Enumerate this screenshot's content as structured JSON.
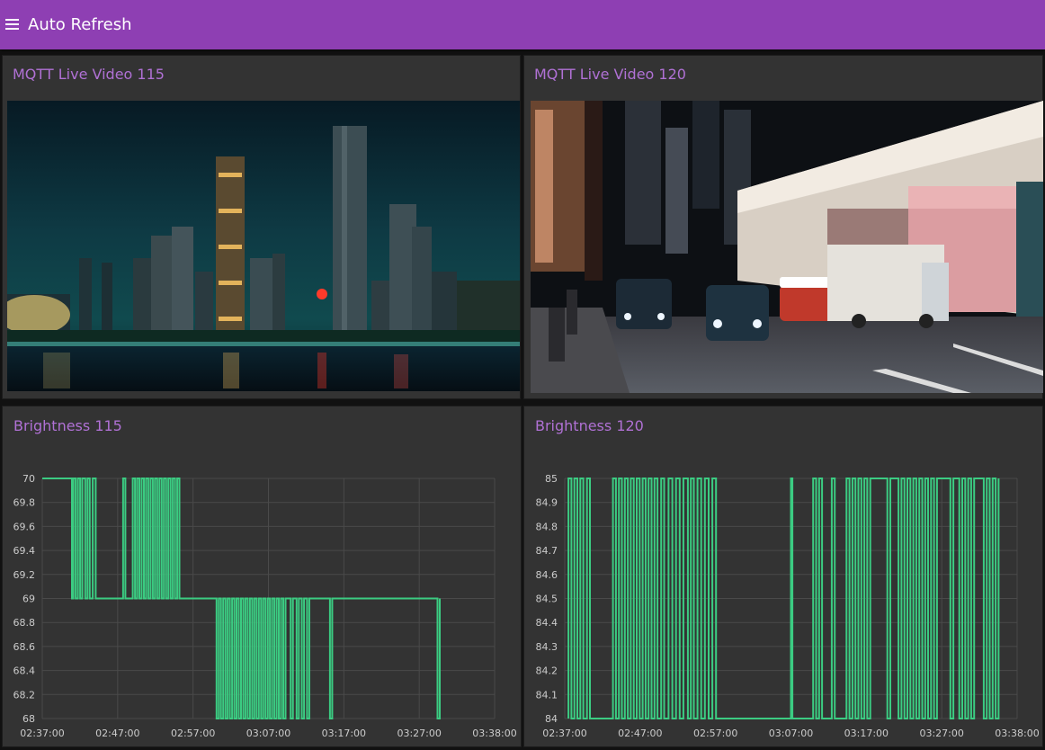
{
  "app": {
    "title": "Auto Refresh",
    "menu_icon": "hamburger-menu-icon"
  },
  "videos": [
    {
      "title": "MQTT Live Video 115",
      "scene": "night-city-skyline-over-river"
    },
    {
      "title": "MQTT Live Video 120",
      "scene": "night-street-with-taxis"
    }
  ],
  "colors": {
    "header": "#8e3fb3",
    "card_title": "#b071d5",
    "card_bg": "#333333",
    "line": "#3bcc82",
    "grid": "#4a4a4a",
    "tick_text": "#cccccc"
  },
  "chart_data": [
    {
      "type": "line",
      "title": "Brightness 115",
      "xlabel": "",
      "ylabel": "",
      "x_ticks": [
        "02:37:00",
        "02:47:00",
        "02:57:00",
        "03:07:00",
        "03:17:00",
        "03:27:00",
        "03:38:00"
      ],
      "x_range_minutes": [
        0,
        61
      ],
      "y_ticks": [
        "70",
        "69.8",
        "69.6",
        "69.4",
        "69.2",
        "69",
        "68.8",
        "68.6",
        "68.4",
        "68.2",
        "68"
      ],
      "ylim": [
        68,
        70
      ],
      "grid": true,
      "series": [
        {
          "color": "#3bcc82",
          "x_minutes": [
            0,
            4,
            4,
            4.2,
            4.2,
            4.5,
            4.5,
            4.8,
            4.8,
            5.1,
            5.1,
            5.4,
            5.4,
            5.8,
            5.8,
            6.1,
            6.1,
            6.4,
            6.4,
            6.8,
            6.8,
            7.2,
            7.2,
            10.9,
            10.9,
            11.2,
            11.2,
            12.2,
            12.2,
            12.5,
            12.5,
            12.8,
            12.8,
            13.1,
            13.1,
            13.4,
            13.4,
            13.7,
            13.7,
            14,
            14,
            14.3,
            14.3,
            14.6,
            14.6,
            14.9,
            14.9,
            15.2,
            15.2,
            15.5,
            15.5,
            15.8,
            15.8,
            16.1,
            16.1,
            16.4,
            16.4,
            16.7,
            16.7,
            17,
            17,
            17.3,
            17.3,
            17.6,
            17.6,
            17.9,
            17.9,
            18.2,
            18.2,
            18.5,
            18.5,
            23.5,
            23.5,
            23.8,
            23.8,
            24.1,
            24.1,
            24.4,
            24.4,
            24.7,
            24.7,
            25,
            25,
            25.3,
            25.3,
            25.6,
            25.6,
            25.9,
            25.9,
            26.2,
            26.2,
            26.5,
            26.5,
            26.8,
            26.8,
            27.1,
            27.1,
            27.4,
            27.4,
            27.7,
            27.7,
            28,
            28,
            28.3,
            28.3,
            28.6,
            28.6,
            28.9,
            28.9,
            29.2,
            29.2,
            29.5,
            29.5,
            29.8,
            29.8,
            30.1,
            30.1,
            30.4,
            30.4,
            30.7,
            30.7,
            31,
            31,
            31.3,
            31.3,
            31.6,
            31.6,
            31.9,
            31.9,
            32.2,
            32.2,
            32.5,
            32.5,
            32.8,
            32.8,
            33.5,
            33.5,
            33.8,
            33.8,
            34.3,
            34.3,
            34.6,
            34.6,
            35,
            35,
            35.3,
            35.3,
            35.7,
            35.7,
            36,
            36,
            38.8,
            38.8,
            39.1,
            39.1,
            53.3,
            53.3,
            53.6,
            53.6,
            61
          ],
          "values": [
            70,
            70,
            69,
            69,
            70,
            70,
            69,
            69,
            70,
            70,
            69,
            69,
            70,
            70,
            69,
            69,
            70,
            70,
            69,
            69,
            70,
            70,
            69,
            69,
            70,
            70,
            69,
            69,
            70,
            70,
            69,
            69,
            70,
            70,
            69,
            69,
            70,
            70,
            69,
            69,
            70,
            70,
            69,
            69,
            70,
            70,
            69,
            69,
            70,
            70,
            69,
            69,
            70,
            70,
            69,
            69,
            70,
            70,
            69,
            69,
            70,
            70,
            69,
            69,
            70,
            70,
            69,
            69,
            70,
            70,
            69,
            69,
            68,
            68,
            69,
            69,
            68,
            68,
            69,
            69,
            68,
            68,
            69,
            69,
            68,
            68,
            69,
            69,
            68,
            68,
            69,
            69,
            68,
            68,
            69,
            69,
            68,
            68,
            69,
            69,
            68,
            68,
            69,
            69,
            68,
            68,
            69,
            69,
            68,
            68,
            69,
            69,
            68,
            68,
            69,
            69,
            68,
            68,
            69,
            69,
            68,
            68,
            69,
            69,
            68,
            68,
            69,
            69,
            68,
            68,
            69,
            69,
            68,
            68,
            69,
            69,
            68,
            68,
            69,
            69,
            68,
            68,
            69,
            69,
            68,
            68,
            69,
            69,
            68,
            68,
            69,
            69,
            68,
            68,
            69,
            69,
            68,
            68,
            69
          ]
        }
      ]
    },
    {
      "type": "line",
      "title": "Brightness 120",
      "xlabel": "",
      "ylabel": "",
      "x_ticks": [
        "02:37:00",
        "02:47:00",
        "02:57:00",
        "03:07:00",
        "03:17:00",
        "03:27:00",
        "03:38:00"
      ],
      "x_range_minutes": [
        0,
        61
      ],
      "y_ticks": [
        "85",
        "84.9",
        "84.8",
        "84.7",
        "84.6",
        "84.5",
        "84.4",
        "84.3",
        "84.2",
        "84.1",
        "84"
      ],
      "ylim": [
        84,
        85
      ],
      "grid": true,
      "series": [
        {
          "color": "#3bcc82",
          "x_minutes": [
            0.5,
            0.5,
            0.9,
            0.9,
            1.3,
            1.3,
            1.7,
            1.7,
            2.1,
            2.1,
            2.5,
            2.5,
            3,
            3,
            3.4,
            3.4,
            6.5,
            6.5,
            6.9,
            6.9,
            7.3,
            7.3,
            7.7,
            7.7,
            8.1,
            8.1,
            8.5,
            8.5,
            8.9,
            8.9,
            9.3,
            9.3,
            9.7,
            9.7,
            10.1,
            10.1,
            10.5,
            10.5,
            10.9,
            10.9,
            11.3,
            11.3,
            11.7,
            11.7,
            12.1,
            12.1,
            12.5,
            12.5,
            13,
            13,
            13.4,
            13.4,
            14,
            14,
            14.5,
            14.5,
            15,
            15,
            15.5,
            15.5,
            16,
            16,
            16.6,
            16.6,
            17,
            17,
            17.4,
            17.4,
            17.9,
            17.9,
            18.4,
            18.4,
            18.9,
            18.9,
            19.4,
            19.4,
            19.9,
            19.9,
            20.4,
            20.4,
            30.5,
            30.5,
            30.7,
            30.7,
            33.5,
            33.5,
            33.9,
            33.9,
            34.3,
            34.3,
            34.7,
            34.7,
            36,
            36,
            36.4,
            36.4,
            38,
            38,
            38.4,
            38.4,
            38.8,
            38.8,
            39.2,
            39.2,
            39.6,
            39.6,
            40,
            40,
            40.4,
            40.4,
            40.8,
            40.8,
            41.2,
            41.2,
            43.5,
            43.5,
            43.9,
            43.9,
            45,
            45,
            45.4,
            45.4,
            45.8,
            45.8,
            46.2,
            46.2,
            46.6,
            46.6,
            47,
            47,
            47.4,
            47.4,
            47.8,
            47.8,
            48.2,
            48.2,
            48.6,
            48.6,
            49,
            49,
            49.4,
            49.4,
            49.8,
            49.8,
            50.2,
            50.2,
            52,
            52,
            52.4,
            52.4,
            53.2,
            53.2,
            53.6,
            53.6,
            54,
            54,
            54.4,
            54.4,
            54.8,
            54.8,
            55.2,
            55.2,
            56.5,
            56.5,
            56.9,
            56.9,
            57.3,
            57.3,
            57.7,
            57.7,
            58.1,
            58.1,
            58.5,
            58.5,
            61
          ],
          "values": [
            84,
            85,
            85,
            84,
            84,
            85,
            85,
            84,
            84,
            85,
            85,
            84,
            84,
            85,
            85,
            84,
            84,
            85,
            85,
            84,
            84,
            85,
            85,
            84,
            84,
            85,
            85,
            84,
            84,
            85,
            85,
            84,
            84,
            85,
            85,
            84,
            84,
            85,
            85,
            84,
            84,
            85,
            85,
            84,
            84,
            85,
            85,
            84,
            84,
            85,
            85,
            84,
            84,
            85,
            85,
            84,
            84,
            85,
            85,
            84,
            84,
            85,
            85,
            84,
            84,
            85,
            85,
            84,
            84,
            85,
            85,
            84,
            84,
            85,
            85,
            84,
            84,
            85,
            85,
            84,
            84,
            85,
            85,
            84,
            84,
            85,
            85,
            84,
            84,
            85,
            85,
            84,
            84,
            85,
            85,
            84,
            84,
            85,
            85,
            84,
            84,
            85,
            85,
            84,
            84,
            85,
            85,
            84,
            84,
            85,
            85,
            84,
            84,
            85,
            85,
            84,
            84,
            85,
            85,
            84,
            84,
            85,
            85,
            84,
            84,
            85,
            85,
            84,
            84,
            85,
            85,
            84,
            84,
            85,
            85,
            84,
            84,
            85,
            85,
            84,
            84,
            85,
            85,
            84,
            84,
            85,
            85,
            84,
            84,
            85,
            85,
            84,
            84,
            85,
            85,
            84,
            84,
            85,
            85,
            84,
            84,
            85,
            85,
            84,
            84,
            85,
            85,
            84,
            84,
            85,
            85,
            84,
            84,
            85
          ]
        }
      ]
    }
  ]
}
